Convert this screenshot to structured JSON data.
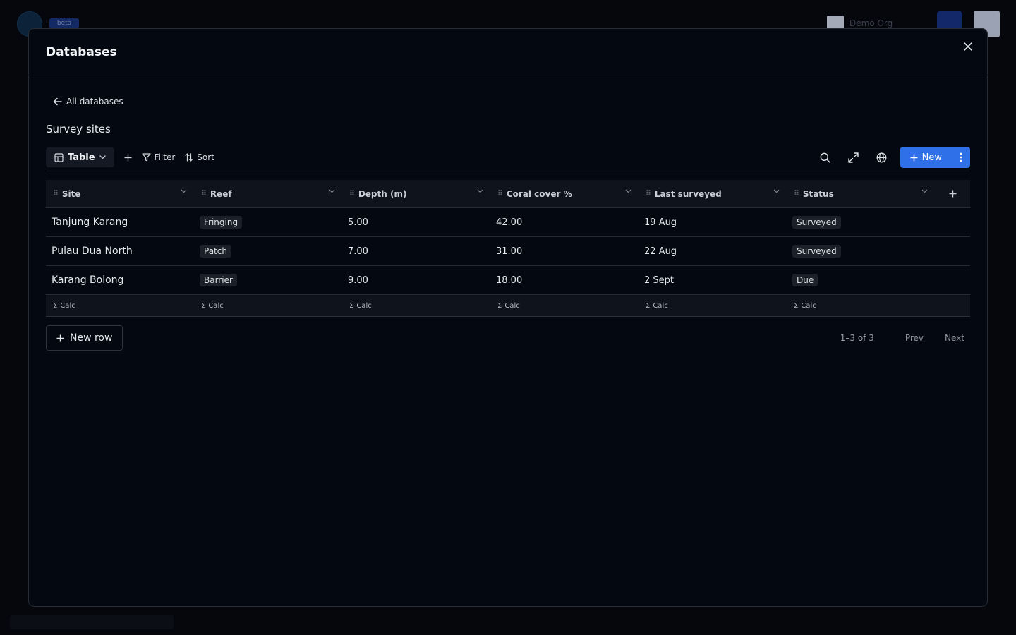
{
  "background": {
    "badge": "beta",
    "org_name": "Demo Org"
  },
  "modal": {
    "title": "Databases",
    "back_label": "All databases",
    "database_title": "Survey sites"
  },
  "toolbar": {
    "view_label": "Table",
    "filter_label": "Filter",
    "sort_label": "Sort",
    "new_label": "New"
  },
  "table": {
    "columns": [
      "Site",
      "Reef",
      "Depth (m)",
      "Coral cover %",
      "Last surveyed",
      "Status"
    ],
    "rows": [
      {
        "site": "Tanjung Karang",
        "reef": "Fringing",
        "depth": "5.00",
        "coral": "42.00",
        "last": "19 Aug",
        "status": "Surveyed"
      },
      {
        "site": "Pulau Dua North",
        "reef": "Patch",
        "depth": "7.00",
        "coral": "31.00",
        "last": "22 Aug",
        "status": "Surveyed"
      },
      {
        "site": "Karang Bolong",
        "reef": "Barrier",
        "depth": "9.00",
        "coral": "18.00",
        "last": "2 Sept",
        "status": "Due"
      }
    ],
    "calc_label": "Calc"
  },
  "footer": {
    "new_row_label": "New row",
    "count": "1–3 of 3",
    "prev_label": "Prev",
    "next_label": "Next"
  },
  "colors": {
    "accent": "#2f6fe8",
    "background": "#040810",
    "border": "#252a35"
  }
}
